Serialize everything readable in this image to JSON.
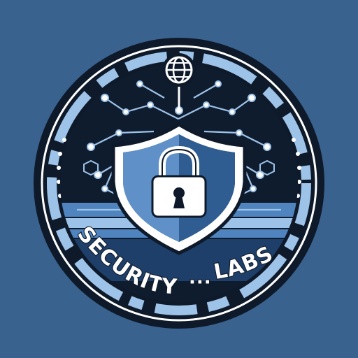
{
  "logo": {
    "left_word": "SECURITY",
    "separator": "···",
    "right_word": "LABS"
  },
  "icons": {
    "top": "globe-icon",
    "center": "padlock-icon",
    "emblem": "shield-icon"
  },
  "colors": {
    "background": "#3a628e",
    "ring_dark": "#0e1a2a",
    "accent_light": "#9ec3e8",
    "accent_mid": "#4f84bf",
    "shield_dark": "#1e3f69",
    "white": "#ffffff"
  }
}
